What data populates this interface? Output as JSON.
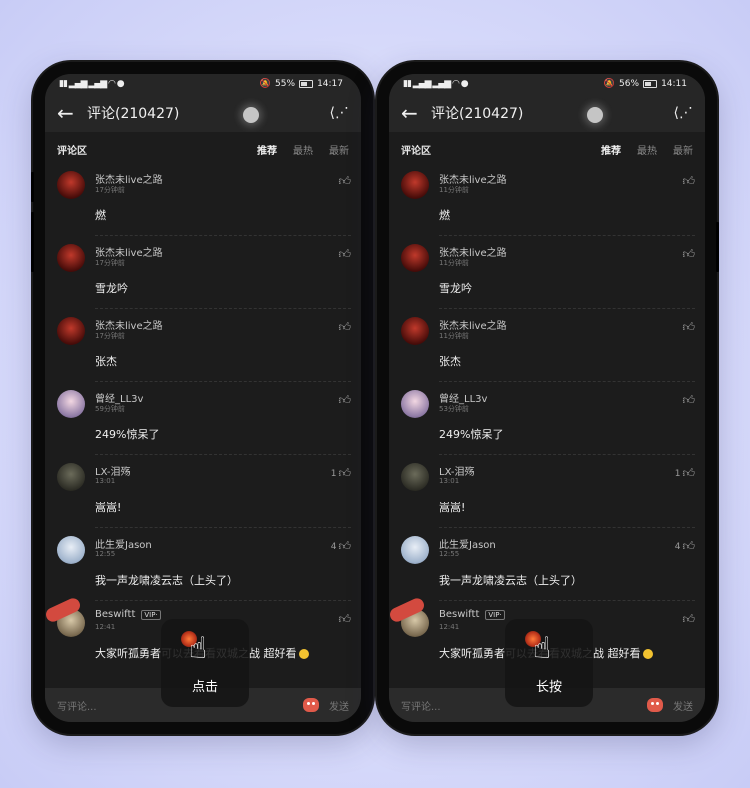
{
  "phones": [
    {
      "status": {
        "battery": "55%",
        "time": "14:17",
        "battery_level": 0.55
      },
      "header": {
        "title": "评论(210427)"
      },
      "section": {
        "title": "评论区",
        "sort_recommend": "推荐",
        "sort_hot": "最热",
        "sort_new": "最新"
      },
      "comments": [
        {
          "user": "张杰未live之路",
          "time": "17分钟前",
          "text": "燃",
          "likes": ""
        },
        {
          "user": "张杰未live之路",
          "time": "17分钟前",
          "text": "雪龙吟",
          "likes": ""
        },
        {
          "user": "张杰未live之路",
          "time": "17分钟前",
          "text": "张杰",
          "likes": ""
        },
        {
          "user": "曾经_LL3v",
          "time": "59分钟前",
          "text": "249%惊呆了",
          "likes": ""
        },
        {
          "user": "LX-泪殇",
          "time": "13:01",
          "text": "嵩嵩!",
          "likes": "1"
        },
        {
          "user": "此生爱Jason",
          "time": "12:55",
          "text": "我一声龙啸凌云志（上头了）",
          "likes": "4"
        },
        {
          "user": "Beswiftt",
          "time": "12:41",
          "text": "大家听孤勇者可以去看看双城之战 超好看",
          "likes": "",
          "vip": "VIP·"
        }
      ],
      "composer": {
        "placeholder": "写评论...",
        "send": "发送"
      },
      "gesture": {
        "label": "点击"
      }
    },
    {
      "status": {
        "battery": "56%",
        "time": "14:11",
        "battery_level": 0.56
      },
      "header": {
        "title": "评论(210427)"
      },
      "section": {
        "title": "评论区",
        "sort_recommend": "推荐",
        "sort_hot": "最热",
        "sort_new": "最新"
      },
      "comments": [
        {
          "user": "张杰未live之路",
          "time": "11分钟前",
          "text": "燃",
          "likes": ""
        },
        {
          "user": "张杰未live之路",
          "time": "11分钟前",
          "text": "雪龙吟",
          "likes": ""
        },
        {
          "user": "张杰未live之路",
          "time": "11分钟前",
          "text": "张杰",
          "likes": ""
        },
        {
          "user": "曾经_LL3v",
          "time": "53分钟前",
          "text": "249%惊呆了",
          "likes": ""
        },
        {
          "user": "LX-泪殇",
          "time": "13:01",
          "text": "嵩嵩!",
          "likes": "1"
        },
        {
          "user": "此生爱Jason",
          "time": "12:55",
          "text": "我一声龙啸凌云志（上头了）",
          "likes": "4"
        },
        {
          "user": "Beswiftt",
          "time": "12:41",
          "text": "大家听孤勇者可以去看看双城之战 超好看",
          "likes": "",
          "vip": "VIP·"
        }
      ],
      "composer": {
        "placeholder": "写评论...",
        "send": "发送"
      },
      "gesture": {
        "label": "长按"
      }
    }
  ],
  "colors": {
    "screen_bg": "#1c1c1c",
    "bar_bg": "#262626",
    "accent_red": "#d34a3f",
    "gesture_orange": "#ff7a3a"
  }
}
